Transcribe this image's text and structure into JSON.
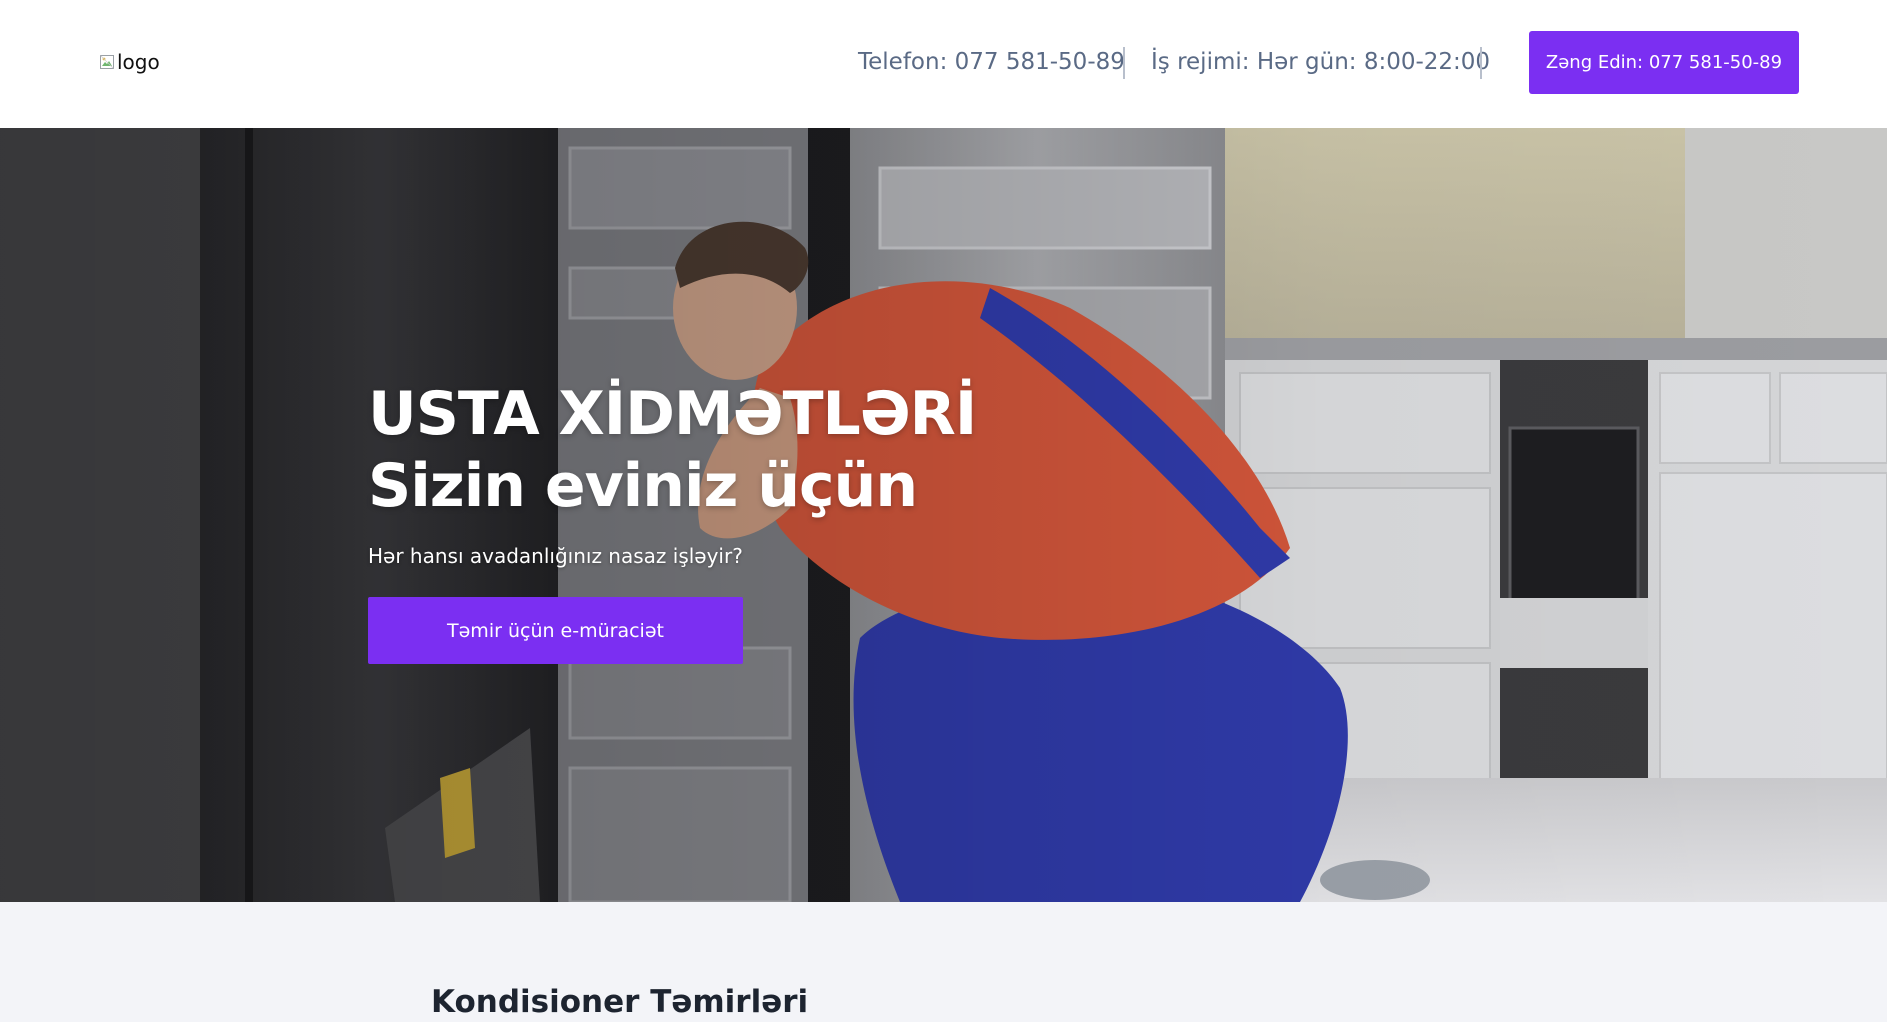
{
  "header": {
    "logo_alt": "logo",
    "phone_info": "Telefon: 077 581-50-89",
    "hours_info": "İş rejimi: Hər gün: 8:00-22:00",
    "call_button_label": "Zəng Edin: 077 581-50-89"
  },
  "hero": {
    "title_line1": "USTA XİDMƏTLƏRİ",
    "title_line2": "Sizin eviniz üçün",
    "subtitle": "Hər hansı avadanlığınız nasaz işləyir?",
    "cta_label": "Təmir üçün e-müraciət"
  },
  "services": {
    "heading": "Kondisioner Təmirləri"
  },
  "colors": {
    "accent": "#7b2ff2",
    "header_text": "#5a6a85",
    "section_bg": "#f3f4f8",
    "heading_text": "#1d2430"
  },
  "icons": {
    "logo": "broken-image-icon"
  }
}
